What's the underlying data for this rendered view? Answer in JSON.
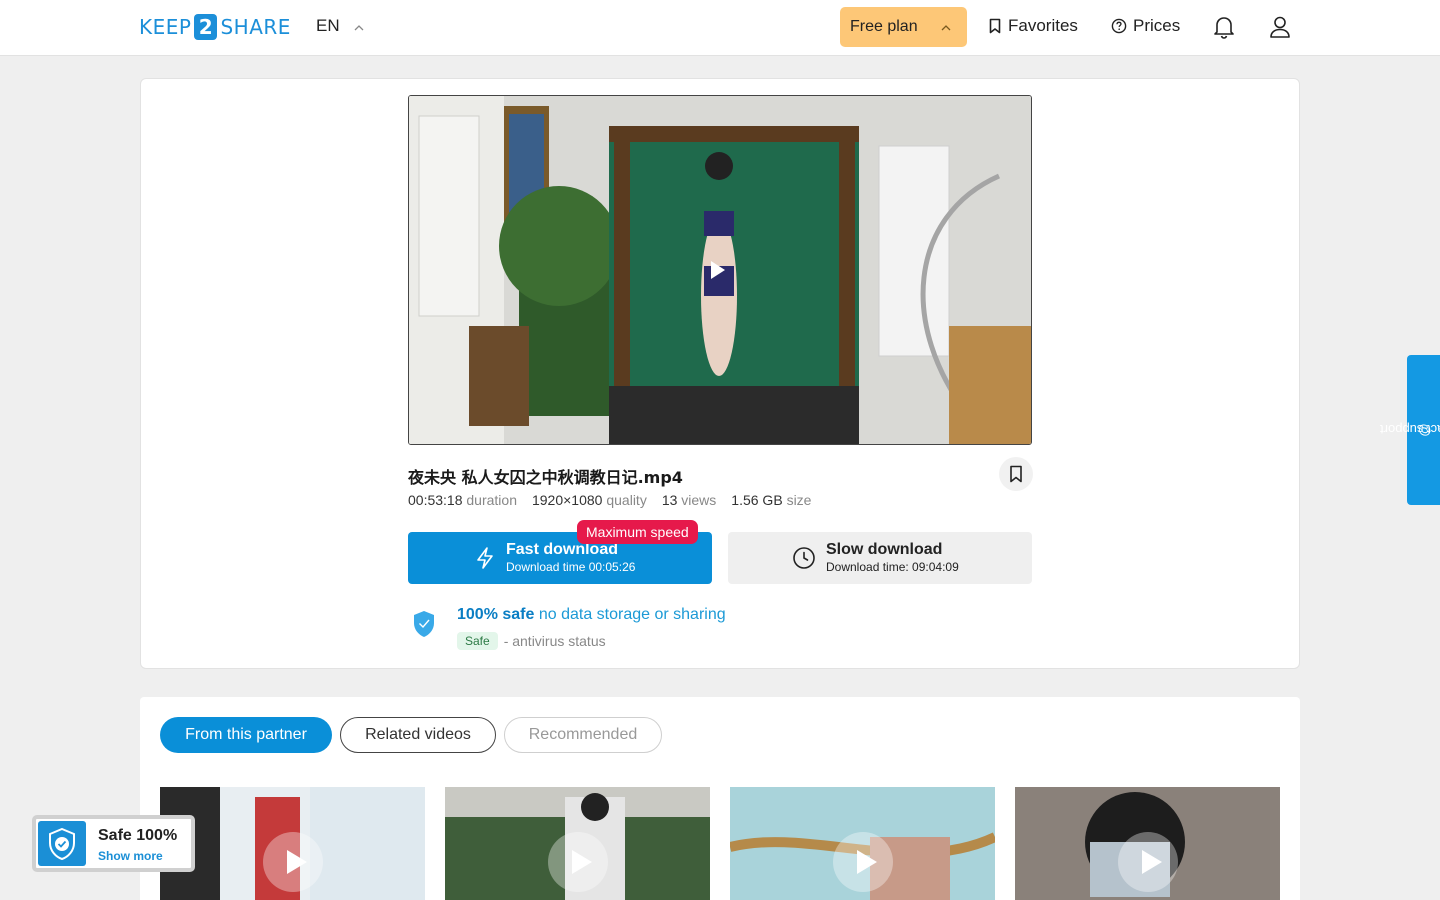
{
  "header": {
    "logo_left": "KEEP",
    "logo_mid": "2",
    "logo_right": "SHARE",
    "language": "EN",
    "plan_label": "Free plan",
    "favorites_label": "Favorites",
    "prices_label": "Prices",
    "icons": [
      "chevron-up-icon",
      "bookmark-icon",
      "help-circle-icon",
      "bell-icon",
      "user-icon"
    ]
  },
  "file": {
    "title": "夜未央 私人女囚之中秋调教日记.mp4",
    "duration_value": "00:53:18",
    "duration_label": "duration",
    "quality_value": "1920×1080",
    "quality_label": "quality",
    "views_value": "13",
    "views_label": "views",
    "size_value": "1.56 GB",
    "size_label": "size"
  },
  "download": {
    "badge": "Maximum speed",
    "fast_label": "Fast download",
    "fast_sub": "Download time 00:05:26",
    "slow_label": "Slow download",
    "slow_sub": "Download time: 09:04:09"
  },
  "safety": {
    "strong": "100% safe",
    "light": "no data storage or sharing",
    "chip": "Safe",
    "antivirus": "- antivirus status"
  },
  "support_label": "contact support",
  "tabs": [
    {
      "label": "From this partner",
      "state": "active"
    },
    {
      "label": "Related videos",
      "state": "outline"
    },
    {
      "label": "Recommended",
      "state": "muted"
    }
  ],
  "safe_widget": {
    "title": "Safe 100%",
    "link": "Show more"
  },
  "colors": {
    "brand": "#1c8fd9",
    "primary_button": "#0a8fd8",
    "plan_button": "#fdc777",
    "badge": "#e6194b"
  }
}
